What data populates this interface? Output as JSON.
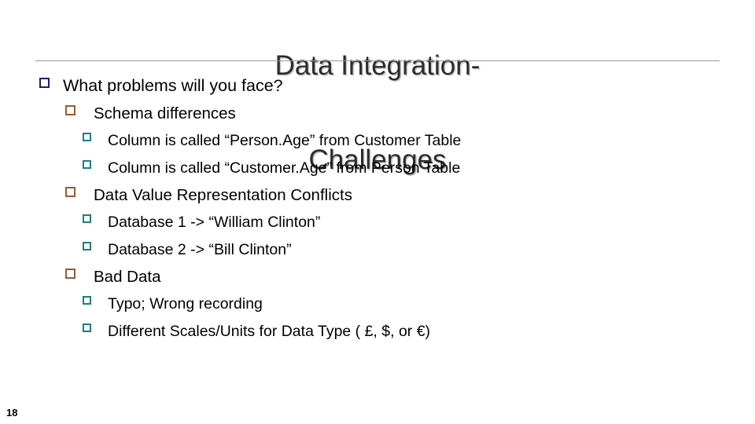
{
  "slide": {
    "title_line1": "Data Integration-",
    "title_line2": "Challenges",
    "page_number": "18",
    "accent_level1_color": "#1b1b7a",
    "accent_level2_color": "#9c5a33",
    "accent_level3_color": "#1d7e82",
    "rule_color": "#9a9a9a",
    "background_color": "#ffffff",
    "text_color": "#000000"
  },
  "bullets": [
    {
      "level": 1,
      "marker": "hollow-square-bullet",
      "text": "What problems will you face?"
    },
    {
      "level": 2,
      "marker": "hollow-square-bullet",
      "text": "Schema differences"
    },
    {
      "level": 3,
      "marker": "hollow-square-bullet",
      "text": "Column is called “Person.Age” from Customer Table"
    },
    {
      "level": 3,
      "marker": "hollow-square-bullet",
      "text": "Column is called “Customer.Age” from Person Table"
    },
    {
      "level": 2,
      "marker": "hollow-square-bullet",
      "text": "Data Value Representation Conflicts"
    },
    {
      "level": 3,
      "marker": "hollow-square-bullet",
      "text": "Database 1 -> “William Clinton”"
    },
    {
      "level": 3,
      "marker": "hollow-square-bullet",
      "text": "Database 2 -> “Bill Clinton”"
    },
    {
      "level": 2,
      "marker": "hollow-square-bullet",
      "text": "Bad Data"
    },
    {
      "level": 3,
      "marker": "hollow-square-bullet",
      "text": "Typo; Wrong recording"
    },
    {
      "level": 3,
      "marker": "hollow-square-bullet",
      "text": "Different Scales/Units for Data Type ( £, $, or €)"
    }
  ]
}
